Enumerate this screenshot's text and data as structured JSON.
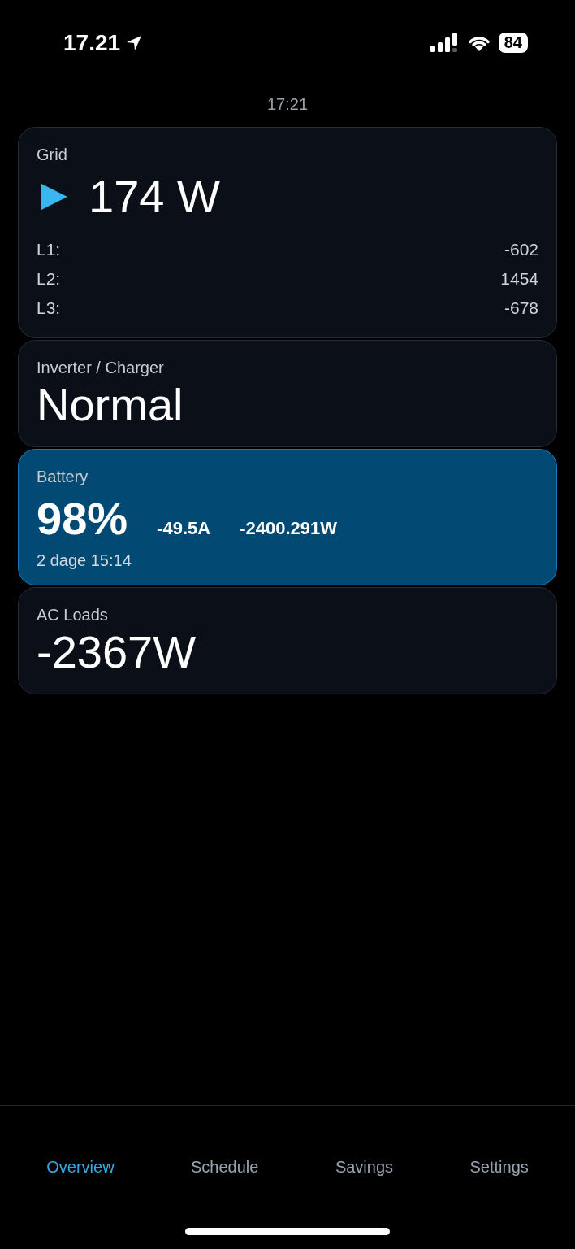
{
  "status_bar": {
    "time": "17.21",
    "battery": "84"
  },
  "updated": "17:21",
  "cards": [
    {
      "kind": "grid",
      "title": "Grid",
      "value": "174 W",
      "phases": [
        {
          "label": "L1:",
          "value": "-602"
        },
        {
          "label": "L2:",
          "value": "1454"
        },
        {
          "label": "L3:",
          "value": "-678"
        }
      ]
    },
    {
      "kind": "status",
      "title": "Inverter / Charger",
      "value": "Normal"
    },
    {
      "kind": "battery",
      "title": "Battery",
      "value": "98%",
      "current": "-49.5A",
      "power": "-2400.291W",
      "remaining": "2 dage 15:14"
    },
    {
      "kind": "value",
      "title": "AC Loads",
      "value": "-2367W"
    }
  ],
  "tabs": [
    {
      "label": "Overview",
      "selected": true
    },
    {
      "label": "Schedule",
      "selected": false
    },
    {
      "label": "Savings",
      "selected": false
    },
    {
      "label": "Settings",
      "selected": false
    }
  ]
}
